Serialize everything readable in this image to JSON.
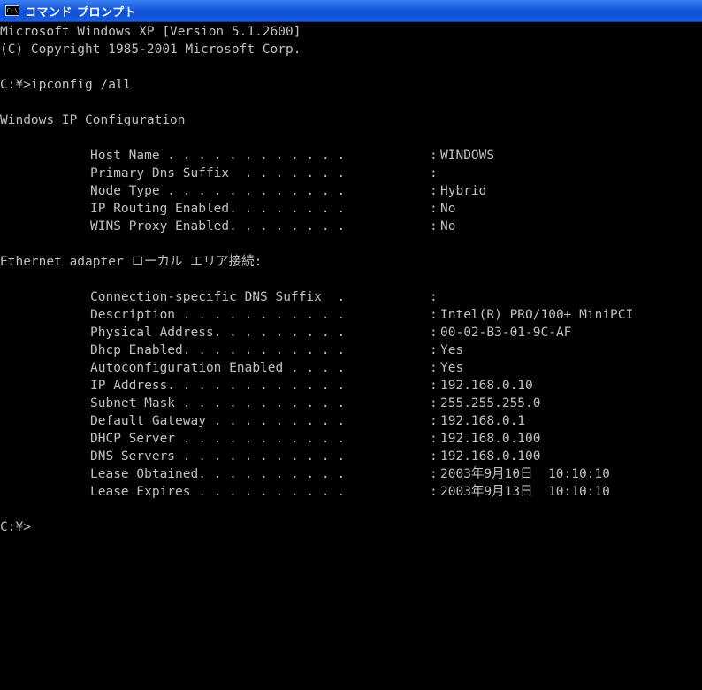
{
  "window": {
    "title": "コマンド プロンプト",
    "icon": "console-icon",
    "icon_label": "C:\\",
    "colors": {
      "titlebar": "#0d4fd6",
      "background": "#000000",
      "text": "#c0c0c0"
    }
  },
  "console": {
    "header1": "Microsoft Windows XP [Version 5.1.2600]",
    "header2": "(C) Copyright 1985-2001 Microsoft Corp.",
    "command": "C:¥>ipconfig /all",
    "section_ip": "Windows IP Configuration",
    "host": {
      "label": "Host Name . . . . . . . . . . . .",
      "value": "WINDOWS"
    },
    "dns_suffix": {
      "label": "Primary Dns Suffix  . . . . . . .",
      "value": ""
    },
    "node_type": {
      "label": "Node Type . . . . . . . . . . . .",
      "value": "Hybrid"
    },
    "ip_routing": {
      "label": "IP Routing Enabled. . . . . . . .",
      "value": "No"
    },
    "wins_proxy": {
      "label": "WINS Proxy Enabled. . . . . . . .",
      "value": "No"
    },
    "section_adapter": "Ethernet adapter ローカル エリア接続:",
    "conn_dns": {
      "label": "Connection-specific DNS Suffix  .",
      "value": ""
    },
    "description": {
      "label": "Description . . . . . . . . . . .",
      "value": "Intel(R) PRO/100+ MiniPCI"
    },
    "physical": {
      "label": "Physical Address. . . . . . . . .",
      "value": "00-02-B3-01-9C-AF"
    },
    "dhcp_enabled": {
      "label": "Dhcp Enabled. . . . . . . . . . .",
      "value": "Yes"
    },
    "autoconfig": {
      "label": "Autoconfiguration Enabled . . . .",
      "value": "Yes"
    },
    "ip": {
      "label": "IP Address. . . . . . . . . . . .",
      "value": "192.168.0.10"
    },
    "subnet": {
      "label": "Subnet Mask . . . . . . . . . . .",
      "value": "255.255.255.0"
    },
    "gateway": {
      "label": "Default Gateway . . . . . . . . .",
      "value": "192.168.0.1"
    },
    "dhcp_server": {
      "label": "DHCP Server . . . . . . . . . . .",
      "value": "192.168.0.100"
    },
    "dns_servers": {
      "label": "DNS Servers . . . . . . . . . . .",
      "value": "192.168.0.100"
    },
    "lease_obtained": {
      "label": "Lease Obtained. . . . . . . . . .",
      "value": "2003年9月10日  10:10:10"
    },
    "lease_expires": {
      "label": "Lease Expires . . . . . . . . . .",
      "value": "2003年9月13日  10:10:10"
    },
    "colon": ":",
    "prompt": "C:¥>"
  }
}
